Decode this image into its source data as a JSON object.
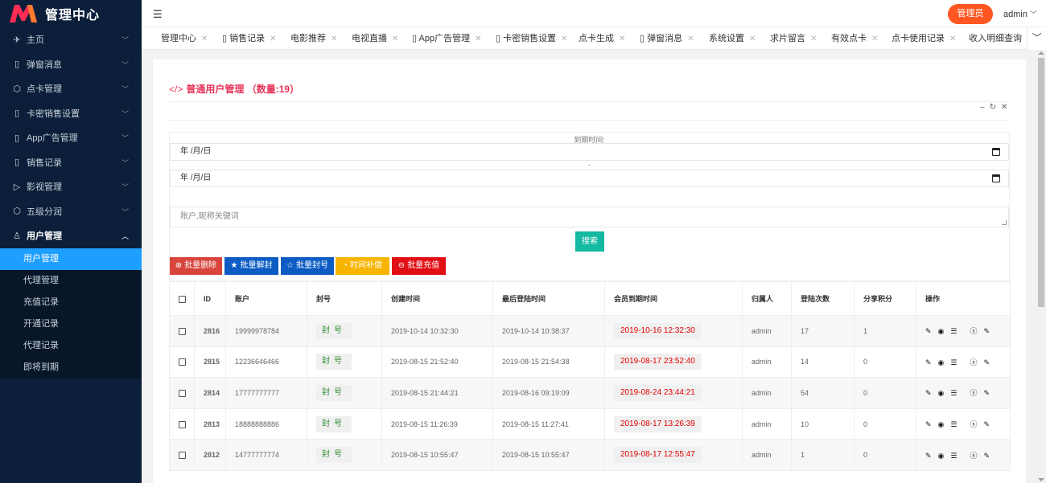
{
  "brand": {
    "title": "管理中心"
  },
  "sidebar": {
    "items": [
      {
        "label": "主页",
        "icon": "send-icon",
        "glyph": "✈"
      },
      {
        "label": "弹窗消息",
        "icon": "phone-icon",
        "glyph": "▯"
      },
      {
        "label": "点卡管理",
        "icon": "cube-icon",
        "glyph": "⬡"
      },
      {
        "label": "卡密销售设置",
        "icon": "phone-icon",
        "glyph": "▯"
      },
      {
        "label": "App广告管理",
        "icon": "phone-icon",
        "glyph": "▯"
      },
      {
        "label": "销售记录",
        "icon": "phone-icon",
        "glyph": "▯"
      },
      {
        "label": "影视管理",
        "icon": "video-icon",
        "glyph": "▷"
      },
      {
        "label": "五级分润",
        "icon": "cube-icon",
        "glyph": "⬡"
      },
      {
        "label": "用户管理",
        "icon": "user-icon",
        "glyph": "♙"
      }
    ],
    "sub_items": [
      "用户管理",
      "代理管理",
      "充值记录",
      "开通记录",
      "代理记录",
      "即将到期"
    ]
  },
  "header": {
    "role": "管理员",
    "user": "admin"
  },
  "tabs": [
    "管理中心",
    "销售记录",
    "电影推荐",
    "电视直播",
    "App广告管理",
    "卡密销售设置",
    "点卡生成",
    "弹窗消息",
    "系统设置",
    "求片留言",
    "有效点卡",
    "点卡使用记录",
    "收入明细查询"
  ],
  "page": {
    "title": "普通用户管理",
    "count_label": "（数量:19）"
  },
  "filter": {
    "expire_label": "到期时间:",
    "date_placeholder": "年 /月/日",
    "date_separator": "-",
    "keyword_placeholder": "账户,昵称关键词",
    "search_label": "搜索"
  },
  "batch_actions": [
    {
      "label": "批量删除",
      "color": "#d9443c"
    },
    {
      "label": "批量解封",
      "color": "#0d5cc4"
    },
    {
      "label": "批量封号",
      "color": "#0d5cc4"
    },
    {
      "label": "时间补偿",
      "color": "#f7b500"
    },
    {
      "label": "批量充值",
      "color": "#e10e14"
    }
  ],
  "table": {
    "headers": [
      "ID",
      "账户",
      "封号",
      "创建时间",
      "最后登陆时间",
      "会员到期时间",
      "归属人",
      "登陆次数",
      "分享积分",
      "操作"
    ],
    "seal_label": "封号",
    "rows": [
      {
        "id": "2816",
        "account": "19999978784",
        "created": "2019-10-14 10:32:30",
        "last_login": "2019-10-14 10:38:37",
        "expire": "2019-10-16 12:32:30",
        "owner": "admin",
        "logins": "17",
        "points": "1"
      },
      {
        "id": "2815",
        "account": "12236646466",
        "created": "2019-08-15 21:52:40",
        "last_login": "2019-08-15 21:54:38",
        "expire": "2019-08-17 23:52:40",
        "owner": "admin",
        "logins": "14",
        "points": "0"
      },
      {
        "id": "2814",
        "account": "17777777777",
        "created": "2019-08-15 21:44:21",
        "last_login": "2019-08-16 09:19:09",
        "expire": "2019-08-24 23:44:21",
        "owner": "admin",
        "logins": "54",
        "points": "0"
      },
      {
        "id": "2813",
        "account": "18888888886",
        "created": "2019-08-15 11:26:39",
        "last_login": "2019-08-15 11:27:41",
        "expire": "2019-08-17 13:26:39",
        "owner": "admin",
        "logins": "10",
        "points": "0"
      },
      {
        "id": "2812",
        "account": "14777777774",
        "created": "2019-08-15 10:55:47",
        "last_login": "2019-08-15 10:55:47",
        "expire": "2019-08-17 12:55:47",
        "owner": "admin",
        "logins": "1",
        "points": "0"
      }
    ]
  }
}
